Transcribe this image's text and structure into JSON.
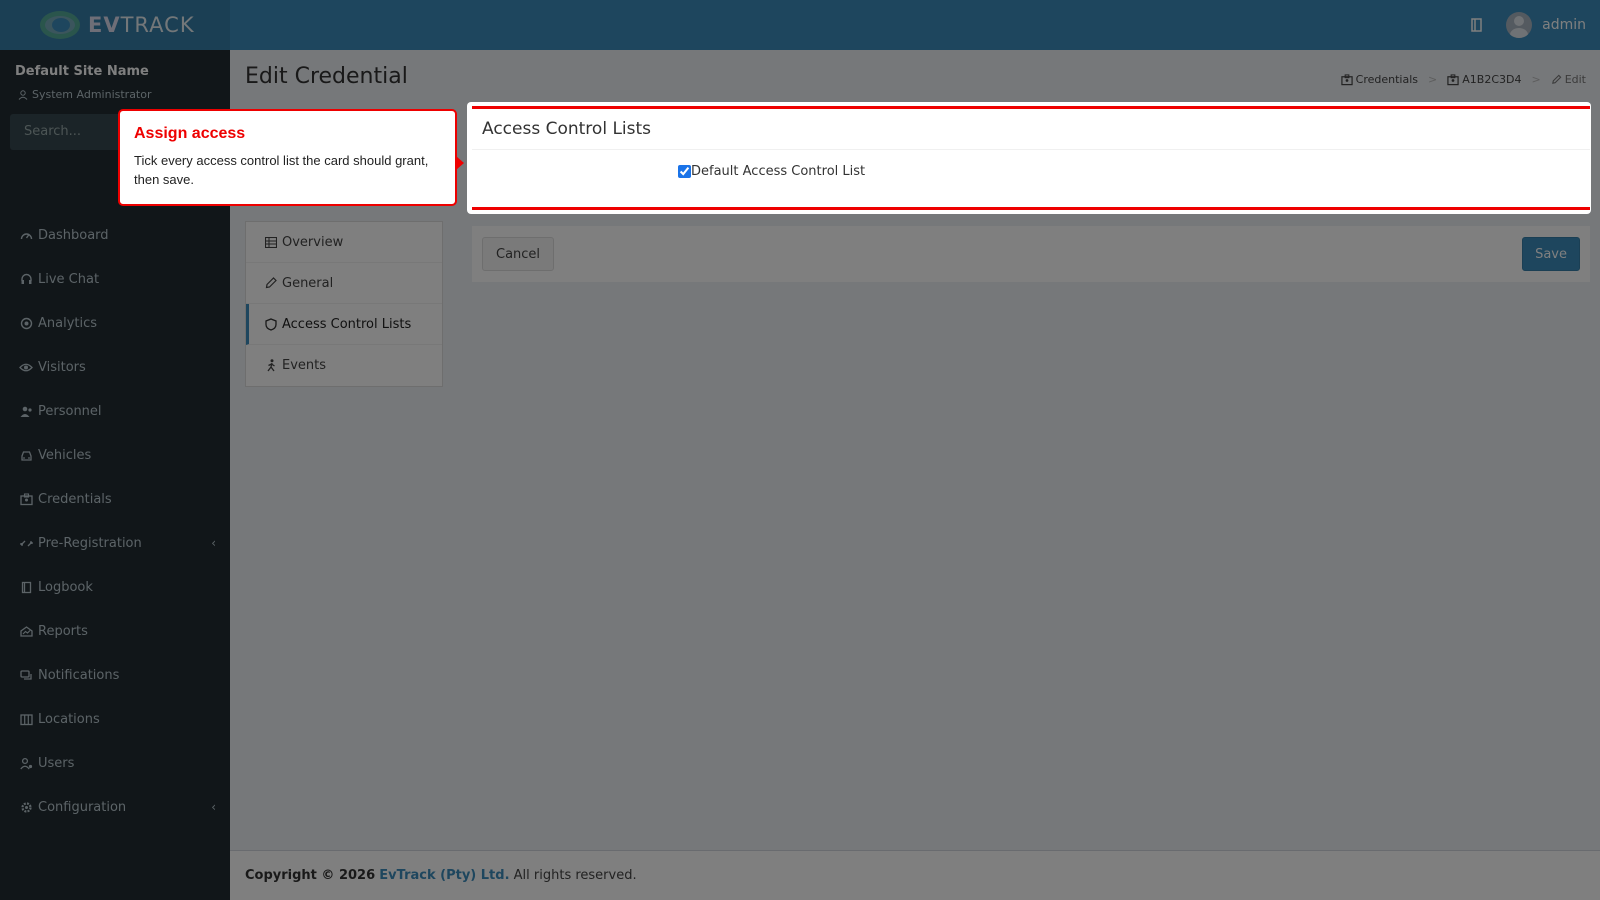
{
  "app": {
    "logo_text_bold": "EV",
    "logo_text_rest": "TRACK",
    "username": "admin"
  },
  "sidebar": {
    "site_name": "Default Site Name",
    "role": "System Administrator",
    "search_placeholder": "Search...",
    "items": [
      {
        "label": "Dashboard",
        "icon": "dashboard-icon"
      },
      {
        "label": "Live Chat",
        "icon": "headset-icon"
      },
      {
        "label": "Analytics",
        "icon": "analytics-icon"
      },
      {
        "label": "Visitors",
        "icon": "eye-icon"
      },
      {
        "label": "Personnel",
        "icon": "personnel-icon"
      },
      {
        "label": "Vehicles",
        "icon": "car-icon"
      },
      {
        "label": "Credentials",
        "icon": "id-card-icon"
      },
      {
        "label": "Pre-Registration",
        "icon": "exchange-icon",
        "expandable": true
      },
      {
        "label": "Logbook",
        "icon": "book-icon"
      },
      {
        "label": "Reports",
        "icon": "reports-icon"
      },
      {
        "label": "Notifications",
        "icon": "chat-icon"
      },
      {
        "label": "Locations",
        "icon": "map-icon"
      },
      {
        "label": "Users",
        "icon": "users-icon"
      },
      {
        "label": "Configuration",
        "icon": "gear-icon",
        "expandable": true
      }
    ]
  },
  "page": {
    "title": "Edit Credential",
    "breadcrumb": [
      {
        "label": "Credentials",
        "icon": "id-card-icon"
      },
      {
        "label": "A1B2C3D4",
        "icon": "id-card-icon"
      },
      {
        "label": "Edit",
        "icon": "pencil-icon"
      }
    ]
  },
  "tabs": [
    {
      "label": "Overview",
      "icon": "table-icon"
    },
    {
      "label": "General",
      "icon": "pencil-icon"
    },
    {
      "label": "Access Control Lists",
      "icon": "shield-icon",
      "active": true
    },
    {
      "label": "Events",
      "icon": "walking-icon"
    }
  ],
  "acl": {
    "title": "Access Control Lists",
    "options": [
      {
        "label": "Default Access Control List",
        "checked": true
      }
    ]
  },
  "actions": {
    "cancel_label": "Cancel",
    "save_label": "Save"
  },
  "footer": {
    "copyright": "Copyright © 2026",
    "company": "EvTrack (Pty) Ltd.",
    "rights": "All rights reserved."
  },
  "tour": {
    "title": "Assign access",
    "body": "Tick every access control list the card should grant, then save."
  },
  "colors": {
    "header": "#3c8dbc",
    "sidebar": "#222d32",
    "accent": "#3c8dbc",
    "tour_highlight": "#ee0000"
  }
}
